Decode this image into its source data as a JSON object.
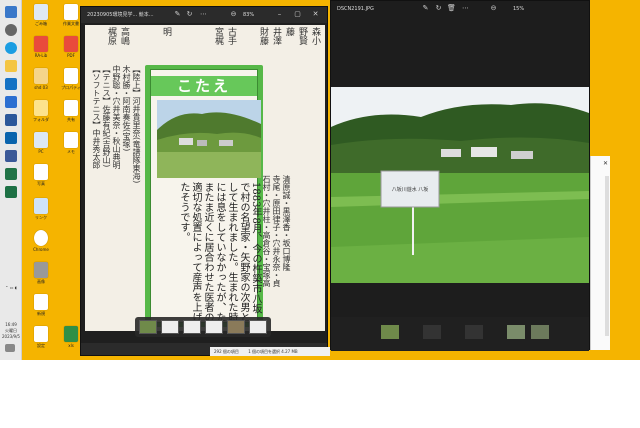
{
  "window1": {
    "title": "20230905環境見学... 競本...",
    "zoom": "83%",
    "answer_heading": "こたえ",
    "answer_text": "1883年8月、今の杵築市八坂で村の名望家・矢野家の次男として生まれました。生まれた時には息をしていなかったが、たまたま近くに居合わせた医者の適切な処置によって産声を上げたそうです。",
    "left_columns": [
      "森小",
      "野賢",
      "藤",
      "野藤",
      "井澤",
      "財藤",
      "古手",
      "宮梶",
      "野",
      "明",
      "高嶋",
      "梶原"
    ],
    "side_columns": [
      "【陸上】河井貴里奈(竜譜隊東海)",
      "木村勝・阿南奏佐(宝塚)",
      "中野聡・穴井美奈・秋山典明",
      "【テニス】佐藤有紀(吉野山)",
      "【ソフトテニス】中井秀太郎",
      "清原誠・黒澤香・坂口博隆",
      "寺尾・原田律子・穴井永奈・貞",
      "石村・穴井柱・高倉谷・宝塚高"
    ]
  },
  "window2": {
    "title": "DSCN2191.JPG",
    "zoom": "15%",
    "sign_text": "八坂川遊水 八坂"
  },
  "statusbar": {
    "count": "292 個の項目",
    "selected": "1 個の項目を選択 4.27 MB"
  },
  "taskbar": {
    "time": "16:49",
    "day": "火曜日",
    "date": "2023/9/5"
  },
  "desktop_icons": [
    {
      "label": "ごみ箱",
      "color": "#dfe9f3"
    },
    {
      "label": "RA-Lib",
      "color": "#e94b3c"
    },
    {
      "label": "shd 03",
      "color": "#f5d58a"
    },
    {
      "label": "フォルダ",
      "color": "#fde38c"
    },
    {
      "label": "PDF",
      "color": "#e94b3c"
    },
    {
      "label": "xls",
      "color": "#2f8f46"
    },
    {
      "label": "作業文書",
      "color": "#ffffff"
    },
    {
      "label": "PC",
      "color": "#dce8f5"
    },
    {
      "label": "写真",
      "color": "#ffffff"
    },
    {
      "label": "リンク",
      "color": "#cfe3f8"
    },
    {
      "label": "プロパティ",
      "color": "#ffffff"
    },
    {
      "label": "共有",
      "color": "#ffffff"
    },
    {
      "label": "Chrome",
      "color": "#ffffff"
    },
    {
      "label": "メモ",
      "color": "#ffffff"
    },
    {
      "label": "画像",
      "color": "#999999"
    },
    {
      "label": "新規",
      "color": "#ffffff"
    },
    {
      "label": "設定",
      "color": "#ffffff"
    }
  ]
}
